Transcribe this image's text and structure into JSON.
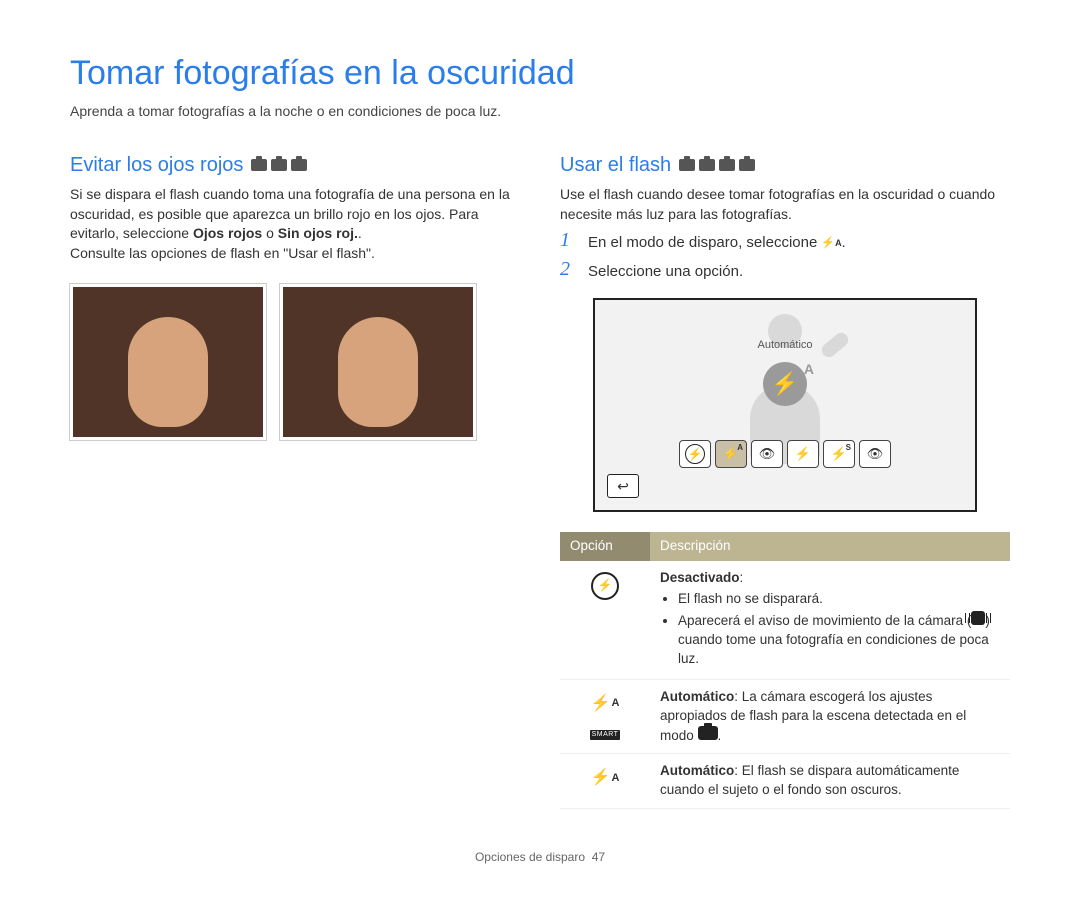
{
  "title": "Tomar fotografías en la oscuridad",
  "subtitle": "Aprenda a tomar fotografías a la noche o en condiciones de poca luz.",
  "left": {
    "heading": "Evitar los ojos rojos",
    "p1": "Si se dispara el flash cuando toma una fotografía de una persona en la oscuridad, es posible que aparezca un brillo rojo en los ojos. Para evitarlo, seleccione ",
    "b1": "Ojos rojos",
    "mid": " o ",
    "b2": "Sin ojos roj.",
    "end": ".",
    "p2": "Consulte las opciones de flash en \"Usar el flash\"."
  },
  "right": {
    "heading": "Usar el flash",
    "intro": "Use el flash cuando desee tomar fotografías en la oscuridad o cuando necesite más luz para las fotografías.",
    "steps": [
      {
        "num": "1",
        "text": "En el modo de disparo, seleccione",
        "trailing_icon": true,
        "trailing": "."
      },
      {
        "num": "2",
        "text": "Seleccione una opción."
      }
    ],
    "lcd_label": "Automático",
    "table": {
      "head": {
        "c1": "Opción",
        "c2": "Descripción"
      },
      "rows": [
        {
          "icon": "flash-off",
          "title": "Desactivado",
          "post_title": ":",
          "bullets": [
            "El flash no se disparará.",
            "Aparecerá el aviso de movimiento de la cámara (ICON_SHAKE) cuando tome una fotografía en condiciones de poca luz."
          ]
        },
        {
          "icon": "flash-auto-smart",
          "title": "Automático",
          "post_title": ": La cámara escogerá los ajustes apropiados de flash para la escena detectada en el modo ",
          "trailing_smart_icon": true,
          "trailing": "."
        },
        {
          "icon": "flash-auto",
          "title": "Automático",
          "post_title": ": El flash se dispara automáticamente cuando el sujeto o el fondo son oscuros."
        }
      ]
    }
  },
  "footer": {
    "section": "Opciones de disparo",
    "page": "47"
  }
}
